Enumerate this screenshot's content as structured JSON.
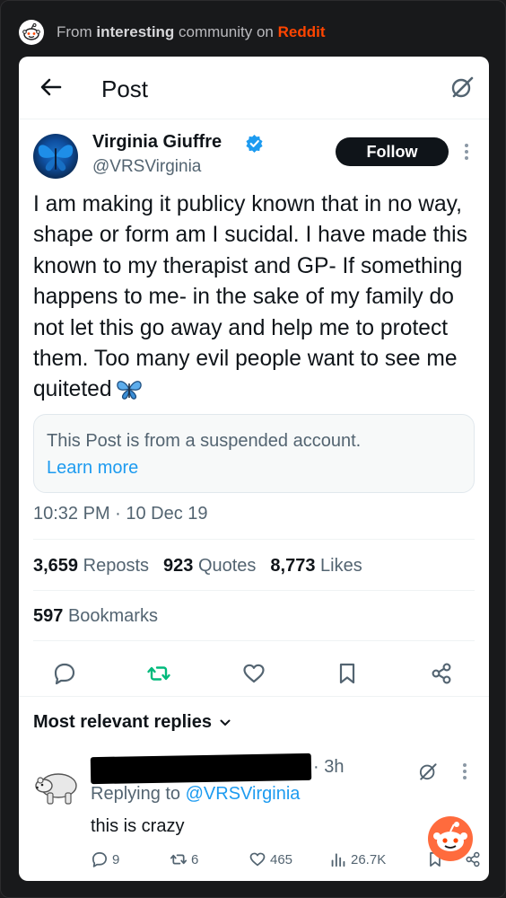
{
  "topbar": {
    "prefix": "From",
    "community": "interesting",
    "middle": "community on",
    "brand": "Reddit",
    "icon": "reddit-snoo-icon"
  },
  "header": {
    "title": "Post",
    "back_icon": "back-arrow-icon",
    "grok_icon": "grok-icon"
  },
  "post": {
    "author_name": "Virginia Giuffre",
    "author_handle": "@VRSVirginia",
    "verified_icon": "verified-badge-icon",
    "follow_label": "Follow",
    "body": "I am making it publicy known that in no way, shape or form am I sucidal. I have made this known to my therapist and GP- If something happens to me- in the sake of my family do not let this go away and help me to protect them. Too many evil people want to see me quiteted",
    "emoji_icon": "butterfly-icon",
    "suspended_notice": "This Post is from a suspended account.",
    "learn_more": "Learn more",
    "timestamp": "10:32 PM · 10 Dec 19",
    "stats": {
      "reposts_count": "3,659",
      "reposts_label": "Reposts",
      "quotes_count": "923",
      "quotes_label": "Quotes",
      "likes_count": "8,773",
      "likes_label": "Likes",
      "bookmarks_count": "597",
      "bookmarks_label": "Bookmarks"
    },
    "actions": [
      "reply-icon",
      "repost-icon",
      "like-icon",
      "bookmark-icon",
      "share-icon"
    ]
  },
  "replies": {
    "header": "Most relevant replies",
    "items": [
      {
        "time": "3h",
        "replying_prefix": "Replying to",
        "replying_handle": "@VRSVirginia",
        "text": "this is crazy",
        "reply_count": "9",
        "repost_count": "6",
        "like_count": "465",
        "views_count": "26.7K"
      }
    ]
  },
  "colors": {
    "background": "#18191b",
    "card": "#ffffff",
    "accent_blue": "#1d9bf0",
    "repost_green": "#00ba7c",
    "reddit_orange": "#ff4500",
    "muted_text": "#536471"
  }
}
